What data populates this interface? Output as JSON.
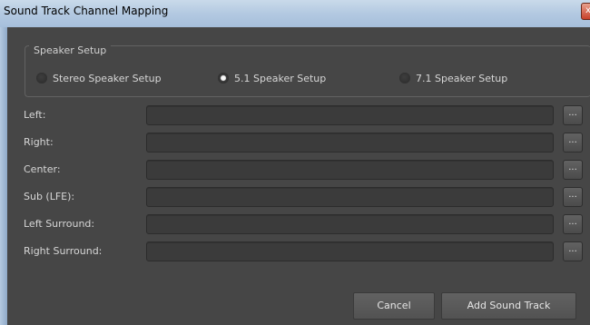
{
  "window": {
    "title": "Sound Track Channel Mapping",
    "close_glyph": "x"
  },
  "speaker_setup": {
    "legend": "Speaker Setup",
    "options": [
      {
        "label": "Stereo Speaker Setup",
        "checked": false
      },
      {
        "label": "5.1 Speaker Setup",
        "checked": true
      },
      {
        "label": "7.1 Speaker Setup",
        "checked": false
      }
    ]
  },
  "channels": [
    {
      "label": "Left:",
      "value": "",
      "browse_label": "..."
    },
    {
      "label": "Right:",
      "value": "",
      "browse_label": "..."
    },
    {
      "label": "Center:",
      "value": "",
      "browse_label": "..."
    },
    {
      "label": "Sub (LFE):",
      "value": "",
      "browse_label": "..."
    },
    {
      "label": "Left Surround:",
      "value": "",
      "browse_label": "..."
    },
    {
      "label": "Right Surround:",
      "value": "",
      "browse_label": "..."
    }
  ],
  "buttons": {
    "cancel": "Cancel",
    "add": "Add Sound Track"
  },
  "colors": {
    "background": "#464646",
    "field": "#3b3b3b",
    "text": "#d6d6d6",
    "titlebar": "#b3c9e1"
  }
}
